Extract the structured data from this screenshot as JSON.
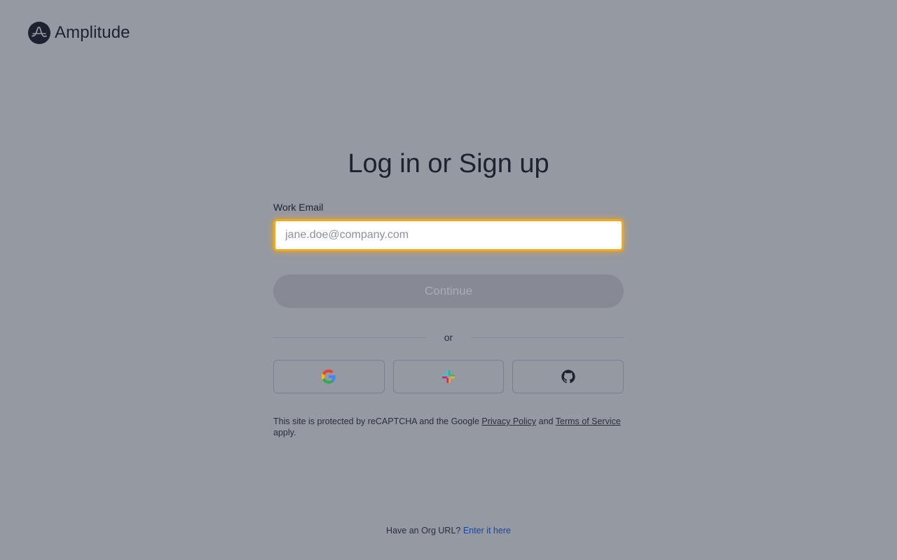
{
  "brand": {
    "name": "Amplitude",
    "icon": "amplitude-logo-icon",
    "color": "#1e2130"
  },
  "form": {
    "title": "Log in or Sign up",
    "email_label": "Work Email",
    "email_placeholder": "jane.doe@company.com",
    "email_value": "",
    "continue_label": "Continue",
    "divider_text": "or",
    "focus_color": "#f2a81d"
  },
  "sso": [
    {
      "name": "google",
      "icon": "google-icon"
    },
    {
      "name": "slack",
      "icon": "slack-icon"
    },
    {
      "name": "github",
      "icon": "github-icon"
    }
  ],
  "legal": {
    "prefix": "This site is protected by reCAPTCHA and the Google ",
    "privacy_label": "Privacy Policy",
    "and": " and ",
    "terms_label": "Terms of Service",
    "suffix": " apply."
  },
  "org": {
    "prompt": "Have an Org URL?",
    "link_label": "Enter it here",
    "link_color": "#1746a2"
  }
}
